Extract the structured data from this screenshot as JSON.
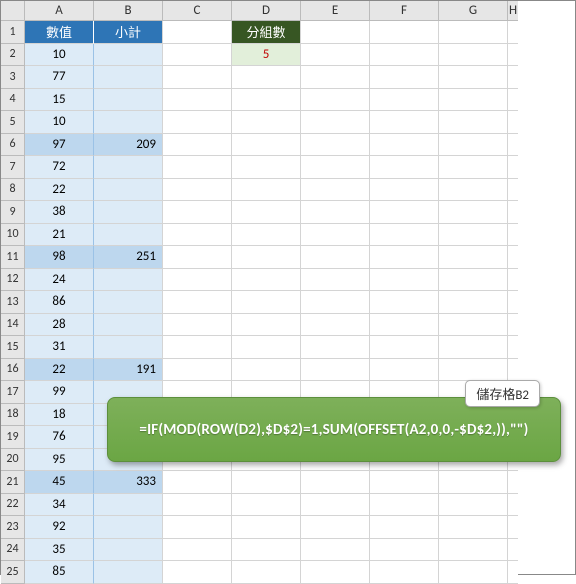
{
  "columns": [
    "A",
    "B",
    "C",
    "D",
    "E",
    "F",
    "G",
    "H"
  ],
  "row_count": 25,
  "headers": {
    "A1": "數值",
    "B1": "小計",
    "D1": "分組數"
  },
  "D2": "5",
  "col_A": [
    "10",
    "77",
    "15",
    "10",
    "97",
    "72",
    "22",
    "38",
    "21",
    "98",
    "24",
    "86",
    "28",
    "31",
    "22",
    "99",
    "18",
    "76",
    "95",
    "45",
    "34",
    "92",
    "35",
    "85"
  ],
  "col_B": {
    "6": "209",
    "11": "251",
    "16": "191",
    "21": "333"
  },
  "tooltip": {
    "label": "儲存格B2",
    "formula": "=IF(MOD(ROW(D2),$D$2)=1,SUM(OFFSET(A2,0,0,-$D$2,)),\"\")"
  },
  "chart_data": {
    "type": "table",
    "title": "Spreadsheet grouped subtotal example",
    "group_size": 5,
    "values": [
      10,
      77,
      15,
      10,
      97,
      72,
      22,
      38,
      21,
      98,
      24,
      86,
      28,
      31,
      22,
      99,
      18,
      76,
      95,
      45,
      34,
      92,
      35,
      85
    ],
    "subtotals": [
      {
        "row": 6,
        "value": 209
      },
      {
        "row": 11,
        "value": 251
      },
      {
        "row": 16,
        "value": 191
      },
      {
        "row": 21,
        "value": 333
      }
    ]
  }
}
